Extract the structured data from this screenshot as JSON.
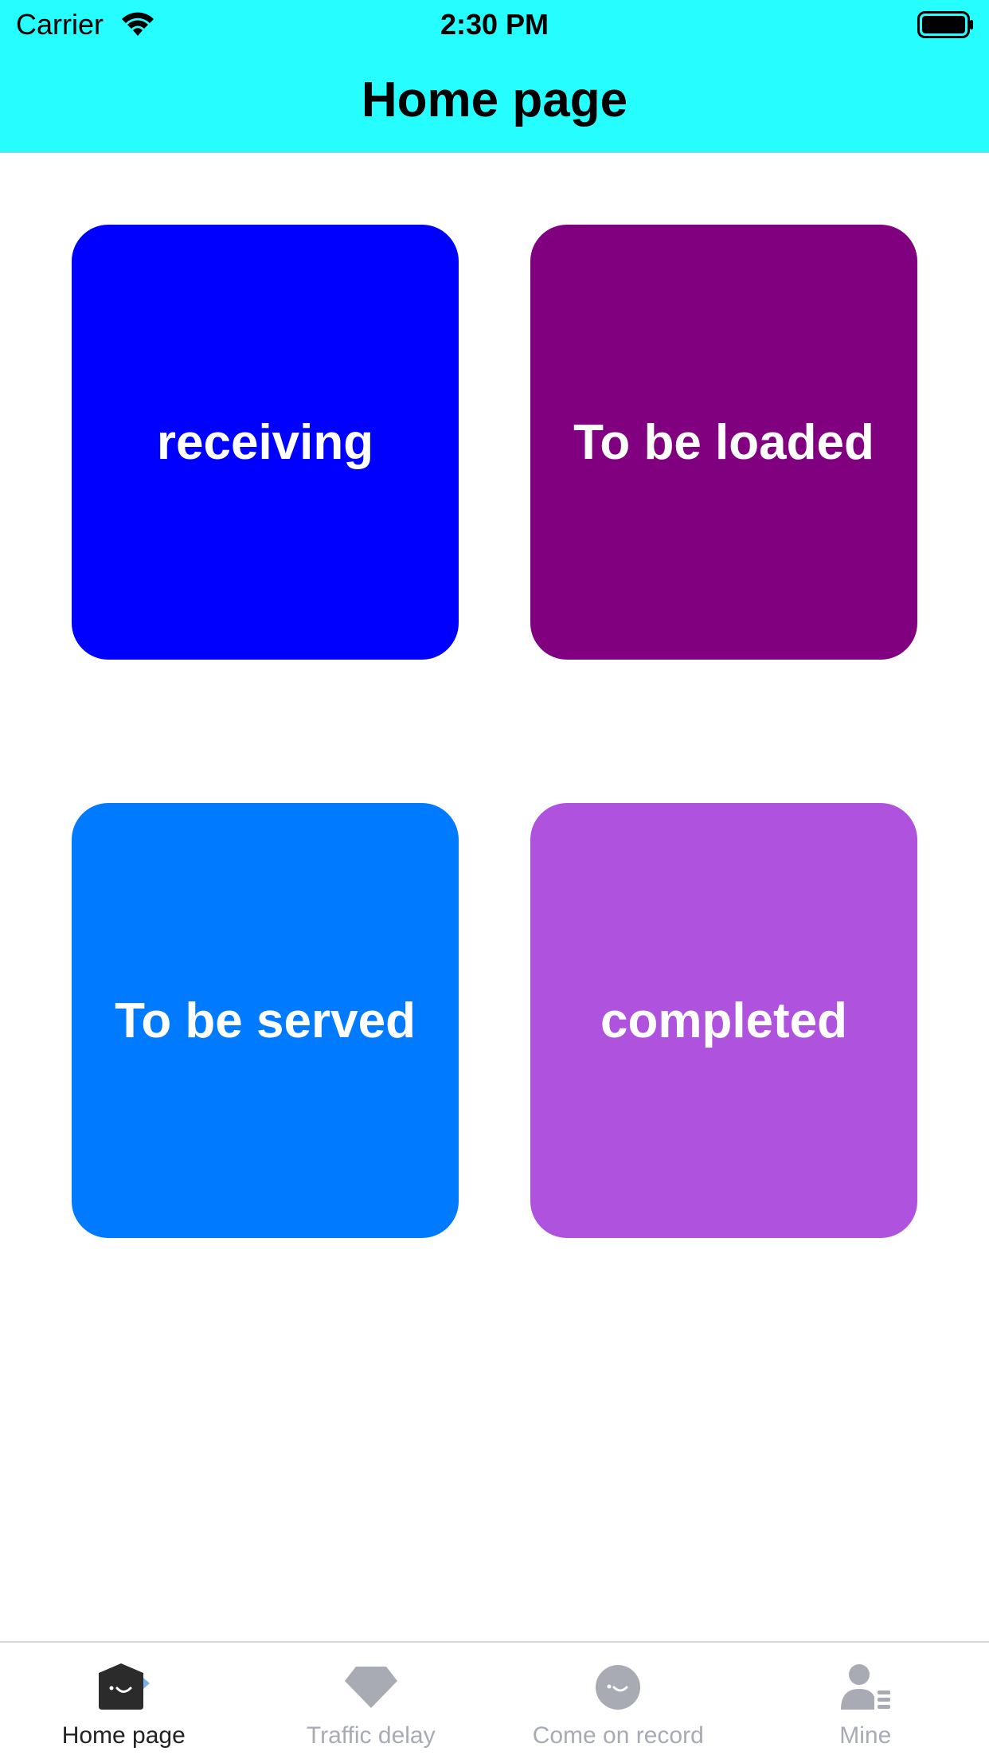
{
  "status_bar": {
    "carrier": "Carrier",
    "time": "2:30 PM"
  },
  "nav": {
    "title": "Home page",
    "background": "#25fdff"
  },
  "tiles": [
    {
      "label": "receiving",
      "color": "#0000ff"
    },
    {
      "label": "To be loaded",
      "color": "#800080"
    },
    {
      "label": "To be served",
      "color": "#007aff"
    },
    {
      "label": "completed",
      "color": "#af52de"
    }
  ],
  "tab_bar": {
    "active_index": 0,
    "active_color": "#222222",
    "inactive_color": "#a8abb4",
    "items": [
      {
        "label": "Home page",
        "icon": "home-icon"
      },
      {
        "label": "Traffic delay",
        "icon": "diamond-icon"
      },
      {
        "label": "Come on record",
        "icon": "smile-face-icon"
      },
      {
        "label": "Mine",
        "icon": "user-list-icon"
      }
    ]
  }
}
